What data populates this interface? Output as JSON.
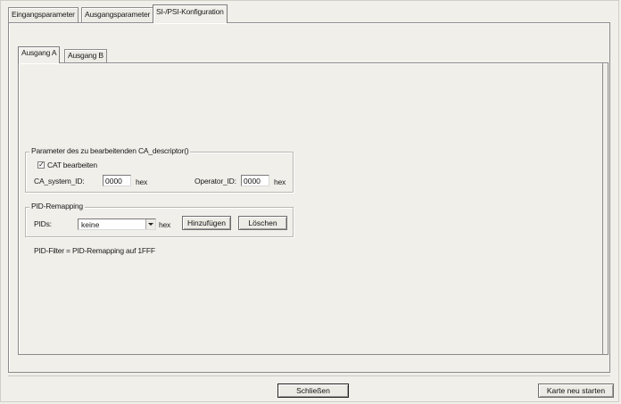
{
  "tabs": [
    {
      "label": "Eingangsparameter",
      "active": false
    },
    {
      "label": "Ausgangsparameter",
      "active": false
    },
    {
      "label": "SI-/PSI-Konfiguration",
      "active": true
    }
  ],
  "subtabs": [
    {
      "label": "Ausgang A",
      "active": true
    },
    {
      "label": "Ausgang B",
      "active": false
    }
  ],
  "ca_group": {
    "title": "Parameter des zu bearbeitenden CA_descriptor()",
    "cat_checkbox_label": "CAT bearbeiten",
    "cat_checked": true,
    "check_mark": "✓",
    "ca_system_id_label": "CA_system_ID:",
    "ca_system_id_value": "0000",
    "hex_unit": "hex",
    "operator_id_label": "Operator_ID:",
    "operator_id_value": "0000"
  },
  "pid_group": {
    "title": "PID-Remapping",
    "pids_label": "PIDs:",
    "pids_selected": "keine",
    "hex_unit": "hex",
    "add_button": "Hinzufügen",
    "delete_button": "Löschen"
  },
  "pid_filter_note": "PID-Filter = PID-Remapping auf 1FFF",
  "footer": {
    "close_button": "Schließen",
    "restart_button": "Karte neu starten"
  }
}
